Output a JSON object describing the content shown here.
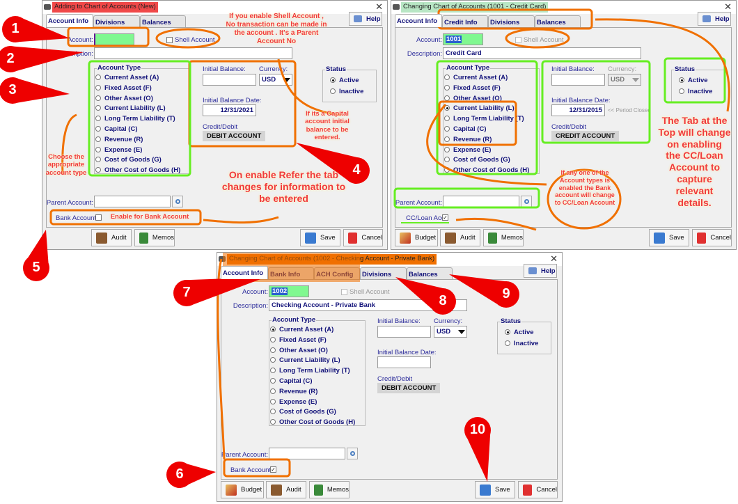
{
  "account_types": [
    "Current Asset (A)",
    "Fixed Asset (F)",
    "Other Asset (O)",
    "Current Liability (L)",
    "Long Term Liability (T)",
    "Capital (C)",
    "Revenue (R)",
    "Expense (E)",
    "Cost of Goods (G)",
    "Other Cost of Goods (H)"
  ],
  "labels": {
    "account": "Account:",
    "description": "Description:",
    "shell": "Shell Account",
    "account_type": "Account Type",
    "initial_balance": "Initial Balance:",
    "currency": "Currency:",
    "initial_balance_date": "Initial Balance Date:",
    "credit_debit": "Credit/Debit",
    "status": "Status",
    "active": "Active",
    "inactive": "Inactive",
    "parent_account": "Parent Account:",
    "help": "Help",
    "budget": "Budget",
    "audit": "Audit",
    "memos": "Memos",
    "save": "Save",
    "cancel": "Cancel",
    "close": "✕"
  },
  "windows": [
    {
      "title": "Adding to Chart of Accounts  (New)",
      "title_color": "#f04848",
      "tabs": [
        "Account Info",
        "Divisions",
        "Balances"
      ],
      "account": "",
      "description": "",
      "shell_enabled": true,
      "selected_type": -1,
      "initial_balance": "",
      "currency": "USD",
      "currency_enabled": true,
      "date": "12/31/2021",
      "period_note": "",
      "credit_debit": "DEBIT ACCOUNT",
      "status": "Active",
      "parent_account": "",
      "flag_label": "Bank Account",
      "flag_checked": false,
      "has_budget": false
    },
    {
      "title": "Changing Chart of Accounts  (1001 - Credit Card)",
      "title_color": "#b8e6c4",
      "tabs": [
        "Account Info",
        "Credit Info",
        "Divisions",
        "Balances"
      ],
      "account": "1001",
      "description": "Credit Card",
      "shell_enabled": false,
      "selected_type": 3,
      "initial_balance": "",
      "currency": "USD",
      "currency_enabled": false,
      "date": "12/31/2015",
      "period_note": "<< Period Closed",
      "credit_debit": "CREDIT ACCOUNT",
      "status": "Active",
      "parent_account": "",
      "flag_label": "CC/Loan Acct",
      "flag_checked": true,
      "has_budget": true
    },
    {
      "title": "Changing Chart of Accounts  (1002 - Checking Account - Private Bank)",
      "title_color": "#f07000",
      "tabs": [
        "Account Info",
        "Bank Info",
        "ACH Config",
        "Divisions",
        "Balances"
      ],
      "account": "1002",
      "description": "Checking Account - Private Bank",
      "shell_enabled": false,
      "selected_type": 0,
      "initial_balance": "",
      "currency": "USD",
      "currency_enabled": true,
      "date": "",
      "period_note": "",
      "credit_debit": "DEBIT ACCOUNT",
      "status": "Active",
      "parent_account": "",
      "flag_label": "Bank Account",
      "flag_checked": true,
      "has_budget": true
    }
  ],
  "annotations": {
    "shell_note": "If you enable Shell Account ,\nNo transaction can be made in\nthe account . It's a Parent\nAccount No",
    "capital_note": "If its a Capital\naccount initial\nbalance to be\nentered.",
    "choose_type": "Choose the\nappropriate\naccount type",
    "tab_change_note": "On enable Refer the tab\nchanges for information to\nbe entered",
    "bank_enable": "Enable for Bank Account",
    "cc_note": "If any one of the\nAccount types  is\nenabled the Bank\naccount will change\nto CC/Loan Account",
    "tab_top_note": "The Tab at the\nTop will change\non enabling\nthe CC/Loan\nAccount to\ncapture\nrelevant\ndetails.",
    "callouts": [
      "1",
      "2",
      "3",
      "4",
      "5",
      "6",
      "7",
      "8",
      "9",
      "10"
    ]
  },
  "colors": {
    "callout": "#ee0000",
    "highlight_orange": "#f07000",
    "highlight_green": "#66ee22",
    "label_blue": "#13137a"
  }
}
